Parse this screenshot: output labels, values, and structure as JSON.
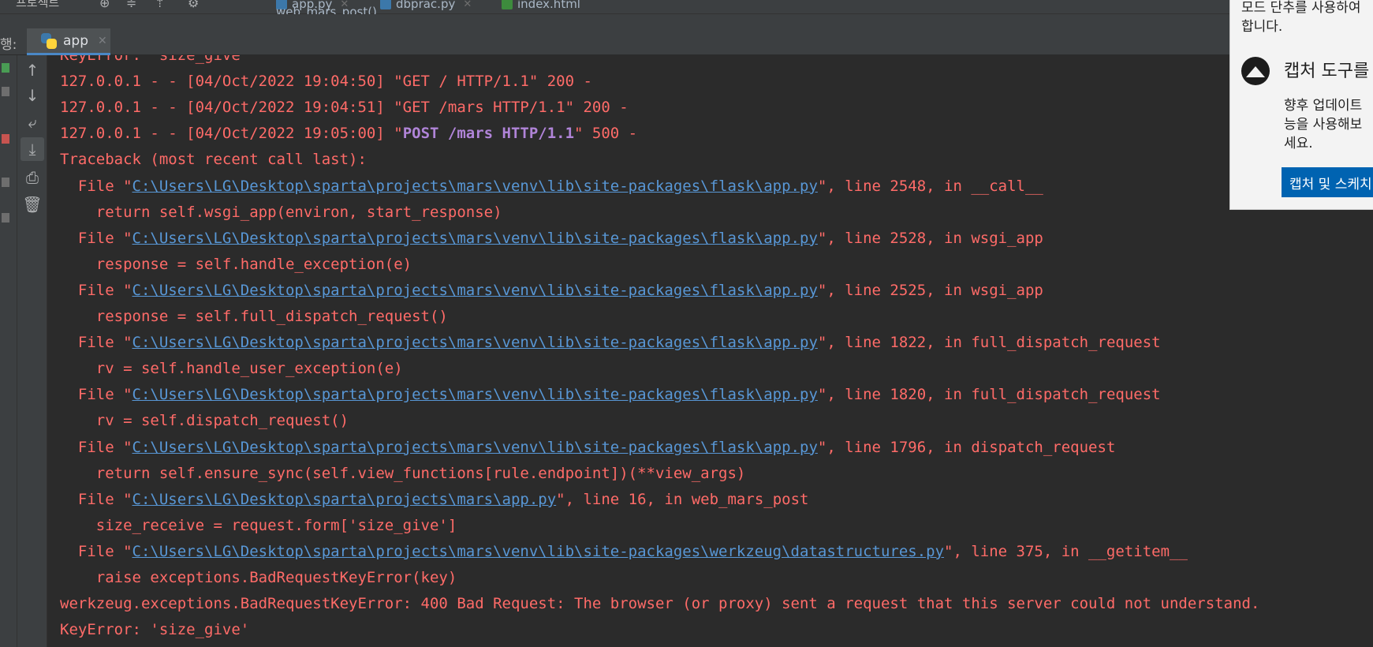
{
  "top_bar": {
    "left_label": "프로젝트",
    "editor_tabs": [
      {
        "label": "app.py",
        "icon": "python-file-icon"
      },
      {
        "label": "dbprac.py",
        "icon": "python-file-icon"
      },
      {
        "label": "index.html",
        "icon": "html-file-icon"
      }
    ],
    "breadcrumb": "web_mars_post()"
  },
  "run_panel": {
    "run_label": "행:",
    "active_tab": "app",
    "toolbar_icons": [
      "arrow-up-icon",
      "arrow-down-icon",
      "soft-wrap-icon",
      "scroll-to-end-icon",
      "print-icon",
      "trash-icon"
    ]
  },
  "console": {
    "lines": [
      {
        "kind": "plain",
        "text": "KeyError: 'size_give'"
      },
      {
        "kind": "plain",
        "text": "127.0.0.1 - - [04/Oct/2022 19:04:50] \"GET / HTTP/1.1\" 200 -"
      },
      {
        "kind": "plain",
        "text": "127.0.0.1 - - [04/Oct/2022 19:04:51] \"GET /mars HTTP/1.1\" 200 -"
      },
      {
        "kind": "request",
        "pre": "127.0.0.1 - - [04/Oct/2022 19:05:00] \"",
        "hl": "POST /mars HTTP/1.1",
        "post": "\" 500 -"
      },
      {
        "kind": "plain",
        "text": "Traceback (most recent call last):"
      },
      {
        "kind": "file",
        "pre": "  File \"",
        "link": "C:\\Users\\LG\\Desktop\\sparta\\projects\\mars\\venv\\lib\\site-packages\\flask\\app.py",
        "post": "\", line 2548, in __call__"
      },
      {
        "kind": "plain",
        "text": "    return self.wsgi_app(environ, start_response)"
      },
      {
        "kind": "file",
        "pre": "  File \"",
        "link": "C:\\Users\\LG\\Desktop\\sparta\\projects\\mars\\venv\\lib\\site-packages\\flask\\app.py",
        "post": "\", line 2528, in wsgi_app"
      },
      {
        "kind": "plain",
        "text": "    response = self.handle_exception(e)"
      },
      {
        "kind": "file",
        "pre": "  File \"",
        "link": "C:\\Users\\LG\\Desktop\\sparta\\projects\\mars\\venv\\lib\\site-packages\\flask\\app.py",
        "post": "\", line 2525, in wsgi_app"
      },
      {
        "kind": "plain",
        "text": "    response = self.full_dispatch_request()"
      },
      {
        "kind": "file",
        "pre": "  File \"",
        "link": "C:\\Users\\LG\\Desktop\\sparta\\projects\\mars\\venv\\lib\\site-packages\\flask\\app.py",
        "post": "\", line 1822, in full_dispatch_request"
      },
      {
        "kind": "plain",
        "text": "    rv = self.handle_user_exception(e)"
      },
      {
        "kind": "file",
        "pre": "  File \"",
        "link": "C:\\Users\\LG\\Desktop\\sparta\\projects\\mars\\venv\\lib\\site-packages\\flask\\app.py",
        "post": "\", line 1820, in full_dispatch_request"
      },
      {
        "kind": "plain",
        "text": "    rv = self.dispatch_request()"
      },
      {
        "kind": "file",
        "pre": "  File \"",
        "link": "C:\\Users\\LG\\Desktop\\sparta\\projects\\mars\\venv\\lib\\site-packages\\flask\\app.py",
        "post": "\", line 1796, in dispatch_request"
      },
      {
        "kind": "plain",
        "text": "    return self.ensure_sync(self.view_functions[rule.endpoint])(**view_args)"
      },
      {
        "kind": "file",
        "pre": "  File \"",
        "link": "C:\\Users\\LG\\Desktop\\sparta\\projects\\mars\\app.py",
        "post": "\", line 16, in web_mars_post"
      },
      {
        "kind": "plain",
        "text": "    size_receive = request.form['size_give']"
      },
      {
        "kind": "file",
        "pre": "  File \"",
        "link": "C:\\Users\\LG\\Desktop\\sparta\\projects\\mars\\venv\\lib\\site-packages\\werkzeug\\datastructures.py",
        "post": "\", line 375, in __getitem__"
      },
      {
        "kind": "plain",
        "text": "    raise exceptions.BadRequestKeyError(key)"
      },
      {
        "kind": "plain",
        "text": "werkzeug.exceptions.BadRequestKeyError: 400 Bad Request: The browser (or proxy) sent a request that this server could not understand."
      },
      {
        "kind": "plain",
        "text": "KeyError: 'size_give'"
      }
    ]
  },
  "notification": {
    "top_message": "모드 단추를 사용하여\n합니다.",
    "app_title": "캡처 도구를",
    "body": "향후 업데이트\n능을 사용해보\n세요.",
    "action_label": "캡처 및 스케치"
  },
  "colors": {
    "console_bg": "#2b2b2b",
    "error_text": "#ff6b68",
    "link": "#5897d6",
    "highlight": "#b084d8",
    "action_blue": "#0063b1"
  }
}
